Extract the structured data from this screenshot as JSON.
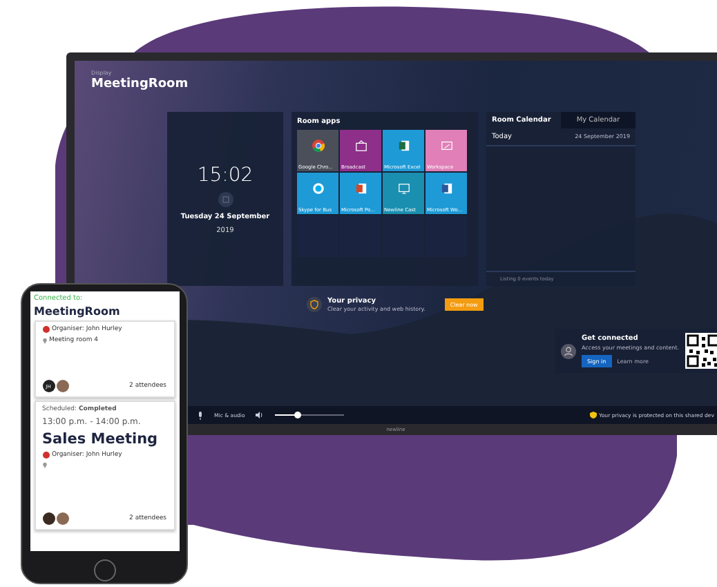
{
  "tv": {
    "brand": "newline",
    "header": {
      "caption": "Display",
      "title": "MeetingRoom"
    },
    "clock": {
      "time": "15:02",
      "date": "Tuesday 24 September",
      "year": "2019"
    },
    "apps": {
      "title": "Room apps",
      "tiles": [
        {
          "label": "Google Chro...",
          "kind": "browser",
          "color": "#4a4f5a"
        },
        {
          "label": "Broadcast",
          "kind": "broadcast",
          "color": "#8e2f8a"
        },
        {
          "label": "Microsoft Excel",
          "kind": "sheet",
          "color": "#1e9ad6"
        },
        {
          "label": "Workspace",
          "kind": "whiteboard",
          "color": "#e07fb8"
        },
        {
          "label": "Skype for Bus",
          "kind": "chat",
          "color": "#1e9ad6"
        },
        {
          "label": "Microsoft Po...",
          "kind": "slides",
          "color": "#1e9ad6"
        },
        {
          "label": "Newline Cast",
          "kind": "cast",
          "color": "#1a8fb0"
        },
        {
          "label": "Microsoft Wo...",
          "kind": "doc",
          "color": "#1e9ad6"
        }
      ]
    },
    "calendar": {
      "tabs": [
        {
          "label": "Room Calendar",
          "selected": true
        },
        {
          "label": "My Calendar",
          "selected": false
        }
      ],
      "day": "Today",
      "date": "24 September 2019",
      "footer": "Listing 0 events today"
    },
    "privacy": {
      "title": "Your privacy",
      "text": "Clear your activity and web history.",
      "button": "Clear now"
    },
    "connect": {
      "title": "Get connected",
      "text": "Access your meetings and content.",
      "sign_in": "Sign in",
      "learn_more": "Learn more"
    },
    "bar": {
      "mic": "Mic & audio",
      "volume": {
        "level": 0.32
      },
      "notice": "Your privacy is protected on this shared dev"
    }
  },
  "phone": {
    "connected_label": "Connected to:",
    "room": "MeetingRoom",
    "cards": [
      {
        "organiser": "Organiser:  John Hurley",
        "location": "Meeting room 4",
        "initials": "JH",
        "attendees": "2 attendees"
      },
      {
        "status": "Scheduled: **Completed**",
        "time": "13:00 p.m. - 14:00 p.m.",
        "title": "Sales Meeting",
        "organiser": "Organiser:  John Hurley",
        "attendees": "2 attendees"
      }
    ]
  }
}
